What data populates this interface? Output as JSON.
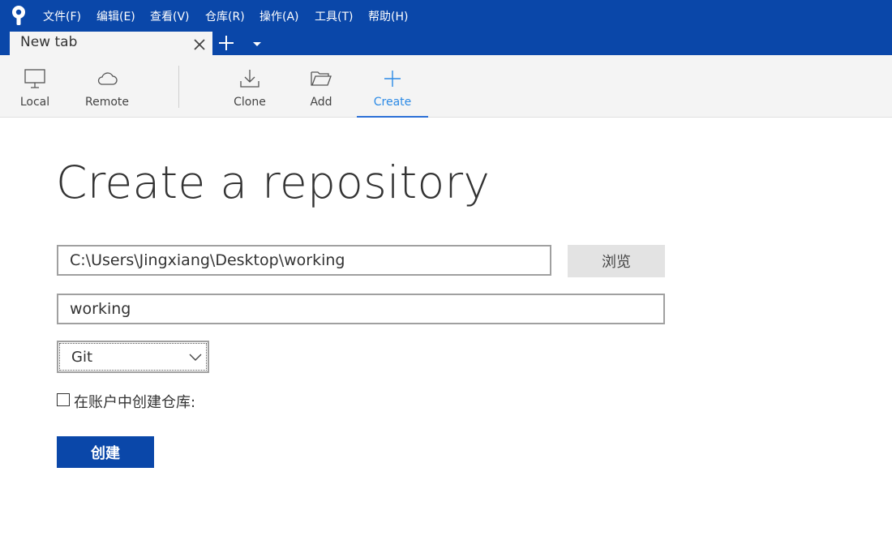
{
  "menubar": {
    "items": [
      "文件(F)",
      "编辑(E)",
      "查看(V)",
      "仓库(R)",
      "操作(A)",
      "工具(T)",
      "帮助(H)"
    ]
  },
  "tabs": {
    "active_label": "New tab"
  },
  "toolbar": {
    "local": "Local",
    "remote": "Remote",
    "clone": "Clone",
    "add": "Add",
    "create": "Create"
  },
  "main": {
    "title": "Create a repository",
    "path_value": "C:\\Users\\Jingxiang\\Desktop\\working",
    "browse_label": "浏览",
    "name_value": "working",
    "vcs_value": "Git",
    "account_label": "在账户中创建仓库:",
    "create_label": "创建"
  },
  "colors": {
    "brand": "#0a47a9",
    "accent": "#2b8ae6",
    "toolbar_bg": "#f4f4f4"
  },
  "icons": {
    "app": "sourcetree-logo",
    "local": "monitor-icon",
    "remote": "cloud-icon",
    "clone": "download-icon",
    "add": "folder-open-icon",
    "create": "plus-icon",
    "tab_close": "close-icon",
    "tab_add": "plus-icon",
    "tab_menu": "caret-down-icon",
    "vcs_select": "chevron-down-icon"
  }
}
